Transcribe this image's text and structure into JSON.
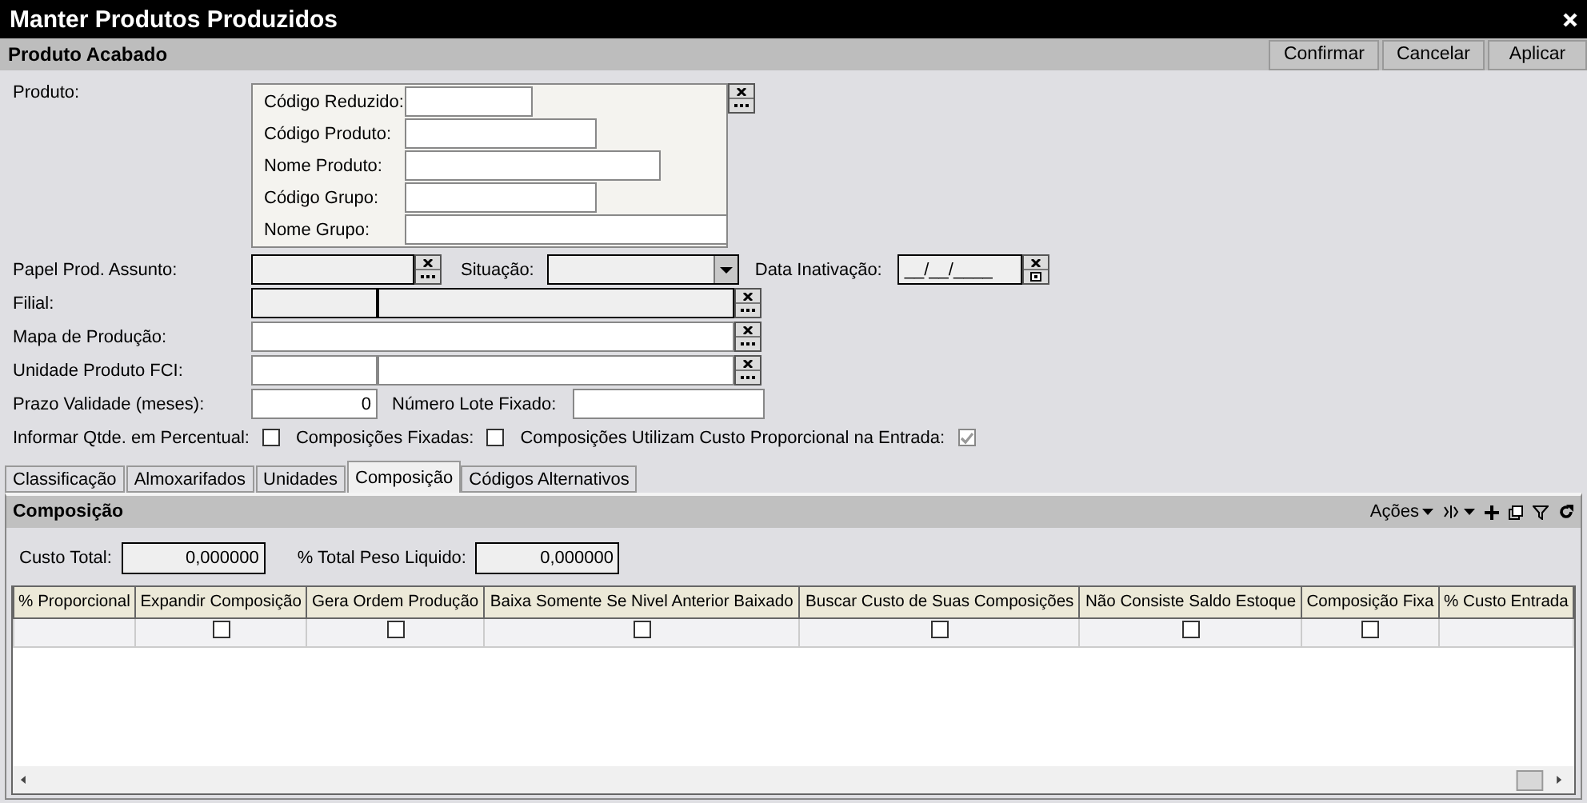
{
  "window": {
    "title": "Manter Produtos Produzidos"
  },
  "header": {
    "title": "Produto Acabado",
    "buttons": [
      "Confirmar",
      "Cancelar",
      "Aplicar"
    ]
  },
  "produto": {
    "label": "Produto:",
    "fields": [
      "Código Reduzido:",
      "Código Produto:",
      "Nome Produto:",
      "Código Grupo:",
      "Nome Grupo:"
    ]
  },
  "papel": {
    "label": "Papel Prod. Assunto:"
  },
  "situacao": {
    "label": "Situação:"
  },
  "data_inativacao": {
    "label": "Data Inativação:",
    "value": "__/__/____"
  },
  "filial": {
    "label": "Filial:"
  },
  "mapa": {
    "label": "Mapa de Produção:"
  },
  "unidade": {
    "label": "Unidade Produto FCI:"
  },
  "prazo": {
    "label": "Prazo Validade (meses):",
    "value": "0"
  },
  "lote": {
    "label": "Número Lote Fixado:"
  },
  "checkboxes": [
    {
      "label": "Informar Qtde. em Percentual:",
      "checked": false,
      "disabled": false
    },
    {
      "label": "Composições Fixadas:",
      "checked": false,
      "disabled": false
    },
    {
      "label": "Composições Utilizam Custo Proporcional na Entrada:",
      "checked": true,
      "disabled": true
    }
  ],
  "tabs": [
    {
      "label": "Classificação",
      "selected": false
    },
    {
      "label": "Almoxarifados",
      "selected": false
    },
    {
      "label": "Unidades",
      "selected": false
    },
    {
      "label": "Composição",
      "selected": true
    },
    {
      "label": "Códigos Alternativos",
      "selected": false
    }
  ],
  "composicao": {
    "title": "Composição",
    "actions": "Ações",
    "custo_total": {
      "label": "Custo Total:",
      "value": "0,000000"
    },
    "peso": {
      "label": "% Total Peso Liquido:",
      "value": "0,000000"
    }
  },
  "table": {
    "columns": [
      "% Proporcional",
      "Expandir Composição",
      "Gera Ordem Produção",
      "Baixa Somente Se Nivel Anterior Baixado",
      "Buscar Custo de Suas Composições",
      "Não Consiste Saldo Estoque",
      "Composição Fixa",
      "% Custo Entrada"
    ],
    "rows": [
      [
        {
          "kind": "text"
        },
        {
          "kind": "checkbox",
          "checked": false
        },
        {
          "kind": "checkbox",
          "checked": false
        },
        {
          "kind": "checkbox",
          "checked": false
        },
        {
          "kind": "checkbox",
          "checked": false
        },
        {
          "kind": "checkbox",
          "checked": false
        },
        {
          "kind": "checkbox",
          "checked": false
        },
        {
          "kind": "text"
        }
      ]
    ]
  }
}
